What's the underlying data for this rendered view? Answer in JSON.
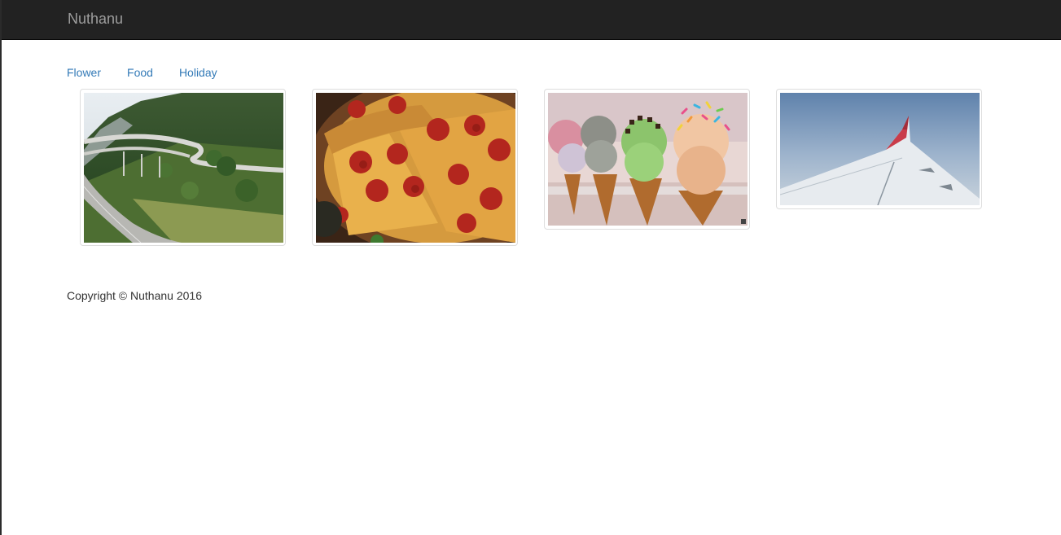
{
  "navbar": {
    "brand": "Nuthanu",
    "background": "#222222",
    "brand_color": "#9d9d9d"
  },
  "tabs": [
    {
      "label": "Flower"
    },
    {
      "label": "Food"
    },
    {
      "label": "Holiday"
    }
  ],
  "accent_color": "#337ab7",
  "gallery": [
    {
      "subject": "mountain highway interchange"
    },
    {
      "subject": "pepperoni pizza"
    },
    {
      "subject": "ice cream cones"
    },
    {
      "subject": "airplane wing above clouds"
    }
  ],
  "footer": {
    "text": "Copyright © Nuthanu 2016"
  }
}
